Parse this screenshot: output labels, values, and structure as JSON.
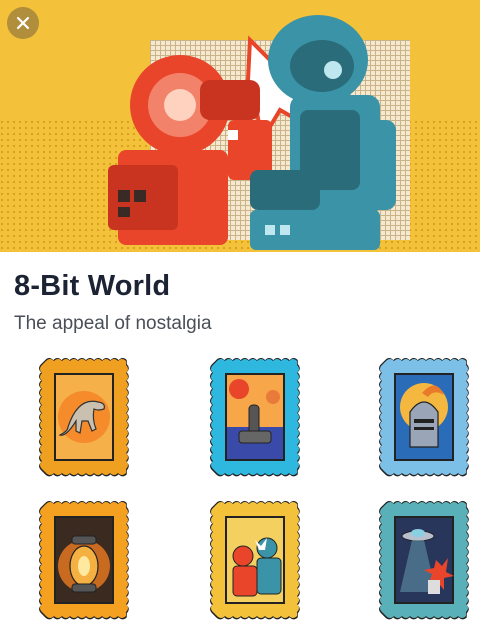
{
  "collection": {
    "title": "8-Bit World",
    "subtitle": "The appeal of nostalgia"
  },
  "close_button": {
    "icon": "close-icon"
  },
  "colors": {
    "banner_yellow": "#f4c23a",
    "robot_red": "#e8452a",
    "robot_teal": "#3a93a6",
    "title_text": "#1c2434"
  },
  "stamps": [
    {
      "subject": "dinosaur",
      "frame_color": "#f0a020",
      "icon": "dinosaur-icon"
    },
    {
      "subject": "joystick",
      "frame_color": "#2eb8e0",
      "icon": "joystick-icon"
    },
    {
      "subject": "knight",
      "frame_color": "#7cc0e8",
      "icon": "knight-helmet-icon"
    },
    {
      "subject": "lantern",
      "frame_color": "#f4a020",
      "icon": "lantern-icon"
    },
    {
      "subject": "boxing-robots",
      "frame_color": "#f4c23a",
      "icon": "robots-icon"
    },
    {
      "subject": "ufo",
      "frame_color": "#5ab0b8",
      "icon": "ufo-icon"
    }
  ]
}
